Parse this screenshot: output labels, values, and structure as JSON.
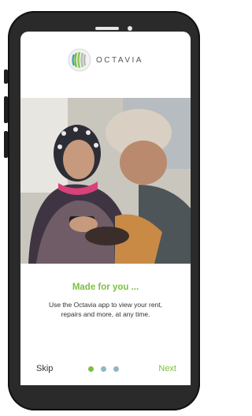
{
  "brand": {
    "name": "OCTAVIA",
    "accent_color": "#7cbf3f"
  },
  "onboarding": {
    "headline": "Made for you ...",
    "body_line1": "Use the Octavia app to view your rent,",
    "body_line2": "repairs and more, at any time.",
    "skip_label": "Skip",
    "next_label": "Next",
    "page_indicator": {
      "total": 3,
      "active_index": 0,
      "active_color": "#7cbf3f",
      "inactive_color": "#8fb8c3"
    }
  },
  "system_nav": {
    "back_icon": "triangle-back-icon",
    "home_icon": "circle-home-icon",
    "recents_icon": "square-recents-icon"
  }
}
